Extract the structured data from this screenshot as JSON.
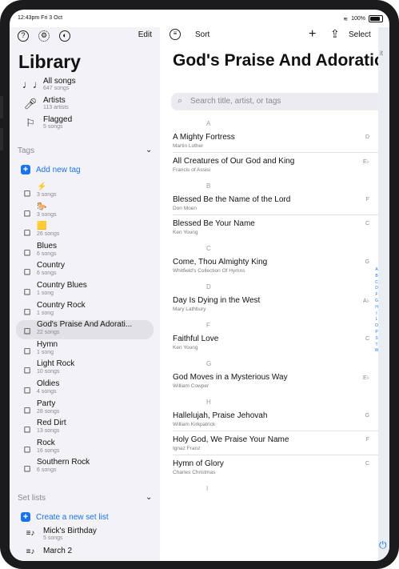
{
  "status": {
    "time_date": "12:43pm  Fri 3 Oct",
    "battery": "100%"
  },
  "sidebar": {
    "edit": "Edit",
    "title": "Library",
    "library_items": [
      {
        "label": "All songs",
        "sub": "647 songs",
        "icon": "music-notes-icon"
      },
      {
        "label": "Artists",
        "sub": "113 artists",
        "icon": "microphone-icon"
      },
      {
        "label": "Flagged",
        "sub": "5 songs",
        "icon": "flag-icon"
      }
    ],
    "tags_header": "Tags",
    "add_tag": "Add new tag",
    "tags": [
      {
        "label": "⚡",
        "sub": "3 songs"
      },
      {
        "label": "🐎",
        "sub": "3 songs"
      },
      {
        "label": "🟨",
        "sub": "26 songs"
      },
      {
        "label": "Blues",
        "sub": "6 songs"
      },
      {
        "label": "Country",
        "sub": "6 songs"
      },
      {
        "label": "Country Blues",
        "sub": "1 song"
      },
      {
        "label": "Country Rock",
        "sub": "1 song"
      },
      {
        "label": "God's Praise And Adorati...",
        "sub": "22 songs"
      },
      {
        "label": "Hymn",
        "sub": "1 song"
      },
      {
        "label": "Light Rock",
        "sub": "10 songs"
      },
      {
        "label": "Oldies",
        "sub": "4 songs"
      },
      {
        "label": "Party",
        "sub": "28 songs"
      },
      {
        "label": "Red Dirt",
        "sub": "13 songs"
      },
      {
        "label": "Rock",
        "sub": "16 songs"
      },
      {
        "label": "Southern Rock",
        "sub": "6 songs"
      }
    ],
    "setlists_header": "Set lists",
    "create_setlist": "Create a new set list",
    "setlists": [
      {
        "label": "Mick's Birthday",
        "sub": "5 songs"
      },
      {
        "label": "March 2",
        "sub": ""
      }
    ]
  },
  "toolbar": {
    "sort": "Sort",
    "select": "Select"
  },
  "main": {
    "title": "God's Praise And Adoration",
    "search_placeholder": "Search title, artist, or tags",
    "sections": [
      {
        "letter": "A",
        "songs": [
          {
            "title": "A Mighty Fortress",
            "artist": "Martin Luther",
            "key": "D"
          },
          {
            "title": "All Creatures of Our God and King",
            "artist": "Francis of Assisi",
            "key": "E♭"
          }
        ]
      },
      {
        "letter": "B",
        "songs": [
          {
            "title": "Blessed Be the Name of the Lord",
            "artist": "Don Moen",
            "key": "F"
          },
          {
            "title": "Blessed Be Your Name",
            "artist": "Ken Young",
            "key": "C"
          }
        ]
      },
      {
        "letter": "C",
        "songs": [
          {
            "title": "Come, Thou Almighty King",
            "artist": "Whitfield's Collection Of Hymns",
            "key": "G"
          }
        ]
      },
      {
        "letter": "D",
        "songs": [
          {
            "title": "Day Is Dying in the West",
            "artist": "Mary Lathbury",
            "key": "A♭"
          }
        ]
      },
      {
        "letter": "F",
        "songs": [
          {
            "title": "Faithful Love",
            "artist": "Ken Young",
            "key": "C"
          }
        ]
      },
      {
        "letter": "G",
        "songs": [
          {
            "title": "God Moves in a Mysterious Way",
            "artist": "William Cowper",
            "key": "E♭"
          }
        ]
      },
      {
        "letter": "H",
        "songs": [
          {
            "title": "Hallelujah, Praise Jehovah",
            "artist": "William Kirkpatrick",
            "key": "G"
          },
          {
            "title": "Holy God, We Praise Your Name",
            "artist": "Ignaz Franz",
            "key": "F"
          },
          {
            "title": "Hymn of Glory",
            "artist": "Charles Christmas",
            "key": "C"
          }
        ]
      },
      {
        "letter": "I",
        "songs": []
      }
    ],
    "index": [
      "A",
      "B",
      "C",
      "D",
      "F",
      "G",
      "H",
      "I",
      "L",
      "O",
      "P",
      "S",
      "T",
      "W"
    ]
  },
  "right_overlay": {
    "edge_text": "it"
  }
}
